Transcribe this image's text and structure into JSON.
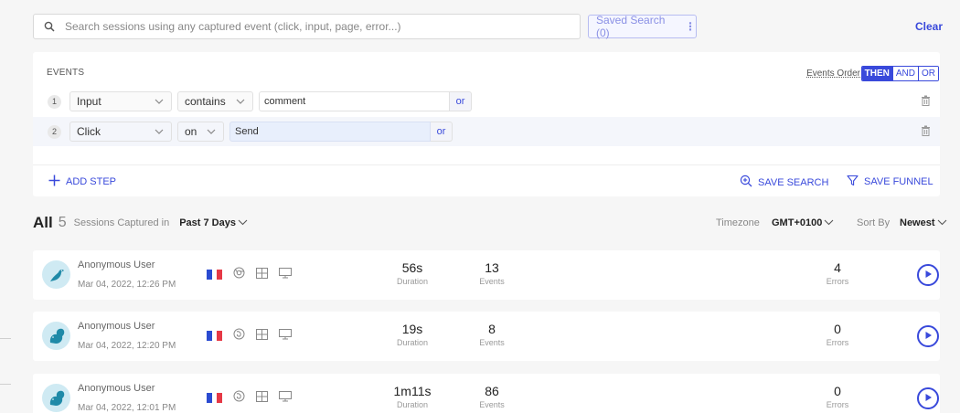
{
  "search": {
    "placeholder": "Search sessions using any captured event (click, input, page, error...)",
    "value": ""
  },
  "saved_search": {
    "label": "Saved Search (0)"
  },
  "clear_label": "Clear",
  "events_panel": {
    "title": "EVENTS",
    "order_label": "Events Order",
    "order_options": [
      "THEN",
      "AND",
      "OR"
    ],
    "order_active": "THEN",
    "steps": [
      {
        "num": "1",
        "event": "Input",
        "operator": "contains",
        "value": "comment",
        "or_label": "or"
      },
      {
        "num": "2",
        "event": "Click",
        "operator": "on",
        "value": "Send",
        "or_label": "or"
      }
    ],
    "add_step_label": "ADD STEP",
    "save_search_label": "SAVE SEARCH",
    "save_funnel_label": "SAVE FUNNEL"
  },
  "summary": {
    "all_label": "All",
    "count": "5",
    "captured_label": "Sessions Captured in",
    "period": "Past 7 Days",
    "timezone_label": "Timezone",
    "timezone_value": "GMT+0100",
    "sort_label": "Sort By",
    "sort_value": "Newest"
  },
  "sessions": [
    {
      "user": "Anonymous User",
      "date": "Mar 04, 2022, 12:26 PM",
      "duration": "56s",
      "duration_label": "Duration",
      "events": "13",
      "events_label": "Events",
      "errors": "4",
      "errors_label": "Errors"
    },
    {
      "user": "Anonymous User",
      "date": "Mar 04, 2022, 12:20 PM",
      "duration": "19s",
      "duration_label": "Duration",
      "events": "8",
      "events_label": "Events",
      "errors": "0",
      "errors_label": "Errors"
    },
    {
      "user": "Anonymous User",
      "date": "Mar 04, 2022, 12:01 PM",
      "duration": "1m11s",
      "duration_label": "Duration",
      "events": "86",
      "events_label": "Events",
      "errors": "0",
      "errors_label": "Errors"
    }
  ],
  "colors": {
    "accent": "#3949db",
    "flag_blue": "#2b4bd1",
    "flag_white": "#ffffff",
    "flag_red": "#e63946"
  },
  "icons": {
    "search": "search-icon",
    "chevron": "chevron-down-icon",
    "trash": "trash-icon",
    "plus": "plus-icon",
    "zoom": "zoom-in-icon",
    "filter": "filter-funnel-icon",
    "play": "play-icon",
    "browser": "browser-icon",
    "os": "windows-icon",
    "device": "desktop-icon"
  }
}
